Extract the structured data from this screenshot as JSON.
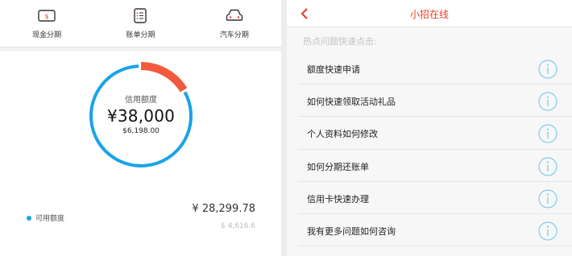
{
  "left": {
    "nav": [
      {
        "label": "现金分期",
        "icon": "cash-icon"
      },
      {
        "label": "账单分期",
        "icon": "bill-list-icon"
      },
      {
        "label": "汽车分期",
        "icon": "car-icon"
      }
    ],
    "credit": {
      "title": "信用额度",
      "limit": "¥38,000",
      "used": "$6,198.00",
      "used_fraction": 0.163
    },
    "legend_label": "可用额度",
    "available_amount": "¥ 28,299.78",
    "other_amount": "$ 4,616.6",
    "colors": {
      "available": "#1aa3e8",
      "used": "#f25a3e"
    }
  },
  "right": {
    "title": "小招在线",
    "hot_label": "热点问题快速点击:",
    "questions": [
      "额度快速申请",
      "如何快速领取活动礼品",
      "个人资料如何修改",
      "如何分期还账单",
      "信用卡快速办理",
      "我有更多问题如何咨询"
    ],
    "accent": "#e8402a",
    "info_icon_color": "#7fcdee"
  }
}
